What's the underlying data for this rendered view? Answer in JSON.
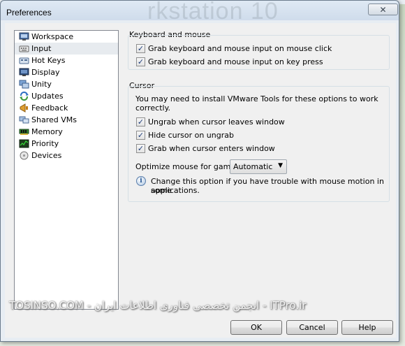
{
  "window": {
    "title": "Preferences",
    "background_title": "rkstation 10",
    "close_glyph": "✕"
  },
  "categories": [
    {
      "label": "Workspace",
      "icon": "workspace-icon"
    },
    {
      "label": "Input",
      "icon": "input-icon",
      "selected": true
    },
    {
      "label": "Hot Keys",
      "icon": "hotkeys-icon"
    },
    {
      "label": "Display",
      "icon": "display-icon"
    },
    {
      "label": "Unity",
      "icon": "unity-icon"
    },
    {
      "label": "Updates",
      "icon": "updates-icon"
    },
    {
      "label": "Feedback",
      "icon": "feedback-icon"
    },
    {
      "label": "Shared VMs",
      "icon": "shared-vms-icon"
    },
    {
      "label": "Memory",
      "icon": "memory-icon"
    },
    {
      "label": "Priority",
      "icon": "priority-icon"
    },
    {
      "label": "Devices",
      "icon": "devices-icon"
    }
  ],
  "keyboard_mouse": {
    "title": "Keyboard and mouse",
    "options": [
      {
        "label": "Grab keyboard and mouse input on mouse click",
        "checked": true
      },
      {
        "label": "Grab keyboard and mouse input on key press",
        "checked": true
      }
    ]
  },
  "cursor": {
    "title": "Cursor",
    "note_line1": "You may need to install VMware Tools for these options to work",
    "note_line2": "correctly.",
    "options": [
      {
        "label": "Ungrab when cursor leaves window",
        "checked": true
      },
      {
        "label": "Hide cursor on ungrab",
        "checked": true
      },
      {
        "label": "Grab when cursor enters window",
        "checked": true
      }
    ],
    "optimize_label": "Optimize mouse for games:",
    "optimize_value": "Automatic",
    "info_line1": "Change this option if you have trouble with mouse motion in some",
    "info_line2": "applications."
  },
  "buttons": {
    "ok": "OK",
    "cancel": "Cancel",
    "help": "Help"
  },
  "watermark": "TOSINSO.COM - انجمن تخصصی فناوری اطلاعات ایران - ITPro.ir",
  "colors": {
    "selection": "#e7ebef",
    "group_border": "#d5dfe5",
    "check": "#1f3d7a"
  }
}
